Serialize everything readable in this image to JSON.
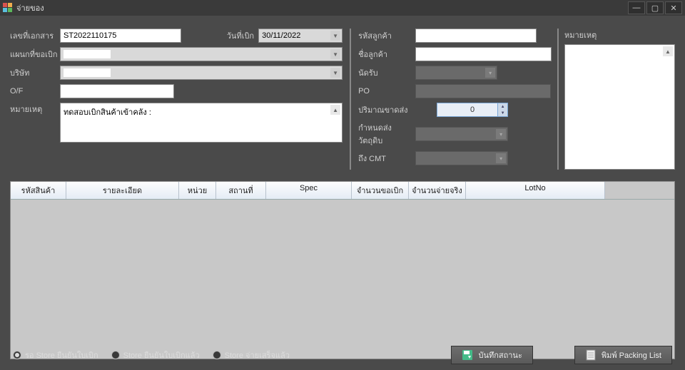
{
  "window": {
    "title": "จ่ายของ"
  },
  "form": {
    "doc_no_label": "เลขที่เอกสาร",
    "doc_no": "ST2022110175",
    "issue_date_label": "วันที่เบิก",
    "issue_date": "30/11/2022",
    "dept_label": "แผนกที่ขอเบิก",
    "dept": "",
    "company_label": "บริษัท",
    "company": "",
    "of_label": "O/F",
    "of": "",
    "remark_label": "หมายเหตุ",
    "remark": "ทดสอบเบิกสินค้าเข้าคลัง :",
    "cust_code_label": "รหัสลูกค้า",
    "cust_code": "",
    "cust_name_label": "ชื่อลูกค้า",
    "cust_name": "",
    "receive_label": "นัดรับ",
    "po_label": "PO",
    "po": "",
    "short_qty_label": "ปริมาณขาดส่ง",
    "short_qty": "0",
    "fabric_date_label": "กำหนดส่งวัตถุดิบ",
    "cmt_label": "ถึง CMT",
    "remark2_label": "หมายเหตุ"
  },
  "grid": {
    "cols": {
      "code": "รหัสสินค้า",
      "detail": "รายละเอียด",
      "unit": "หน่วย",
      "location": "สถานที่",
      "spec": "Spec",
      "req_qty": "จำนวนขอเบิก",
      "pay_qty": "จำนวนจ่ายจริง",
      "lotno": "LotNo"
    }
  },
  "status": {
    "opt1": "รอ Store ยืนยันใบเบิก",
    "opt2": "Store ยืนยันใบเบิกแล้ว",
    "opt3": "Store จ่ายเสร็จแล้ว"
  },
  "buttons": {
    "save_status": "บันทึกสถานะ",
    "print_packing": "พิมพ์ Packing List"
  }
}
